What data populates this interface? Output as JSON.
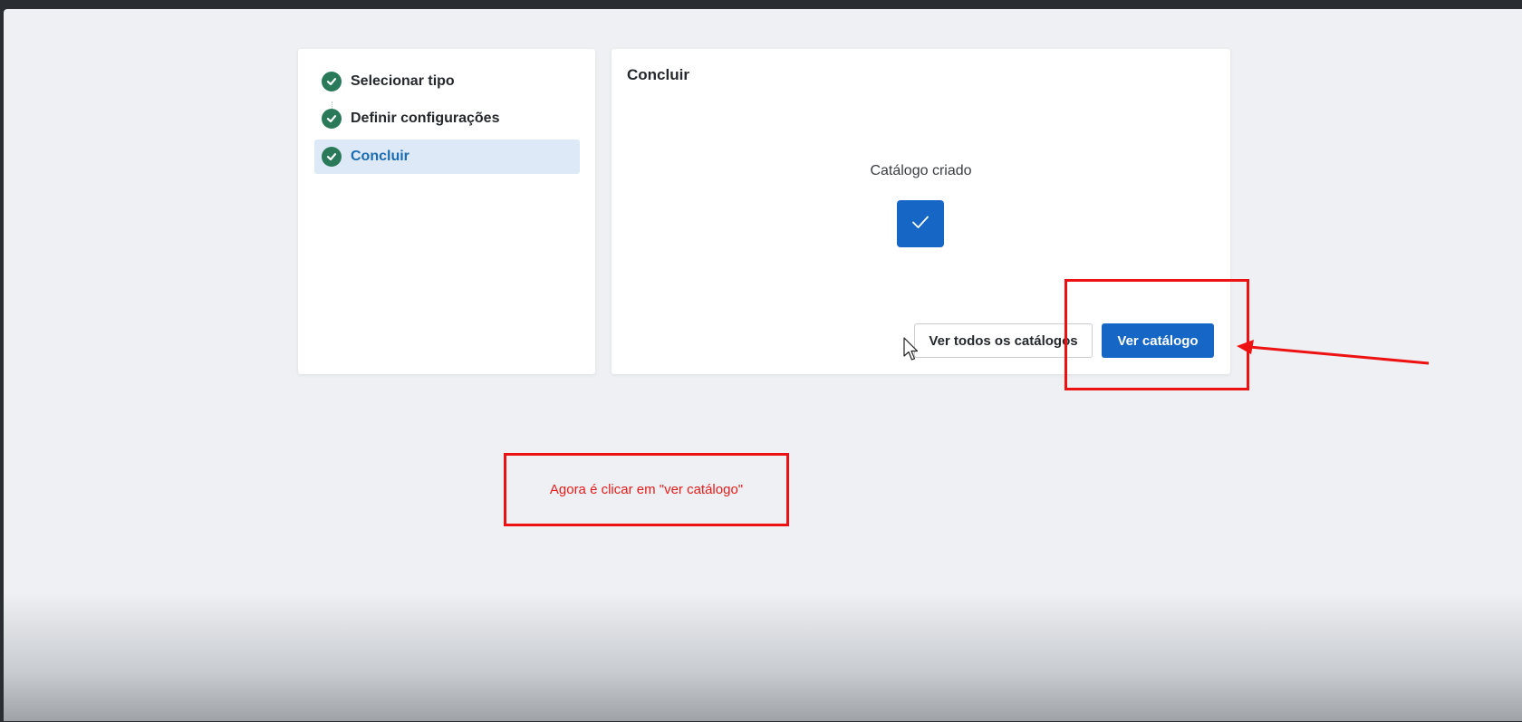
{
  "wizard": {
    "steps": [
      {
        "label": "Selecionar tipo",
        "icon": "check-circle-icon",
        "state": "complete"
      },
      {
        "label": "Definir configurações",
        "icon": "check-circle-icon",
        "state": "complete"
      },
      {
        "label": "Concluir",
        "icon": "check-circle-icon",
        "state": "active"
      }
    ]
  },
  "main": {
    "title": "Concluir",
    "status_text": "Catálogo criado",
    "status_icon": "checkmark-icon",
    "buttons": {
      "secondary_label": "Ver todos os catálogos",
      "primary_label": "Ver catálogo"
    }
  },
  "annotation": {
    "note_text": "Agora é clicar em \"ver catálogo\"",
    "color": "#ee1111"
  },
  "colors": {
    "accent": "#1666c5",
    "step_complete": "#2a7a5a",
    "active_step_bg": "#dde9f6",
    "page_bg": "#eef0f3"
  }
}
